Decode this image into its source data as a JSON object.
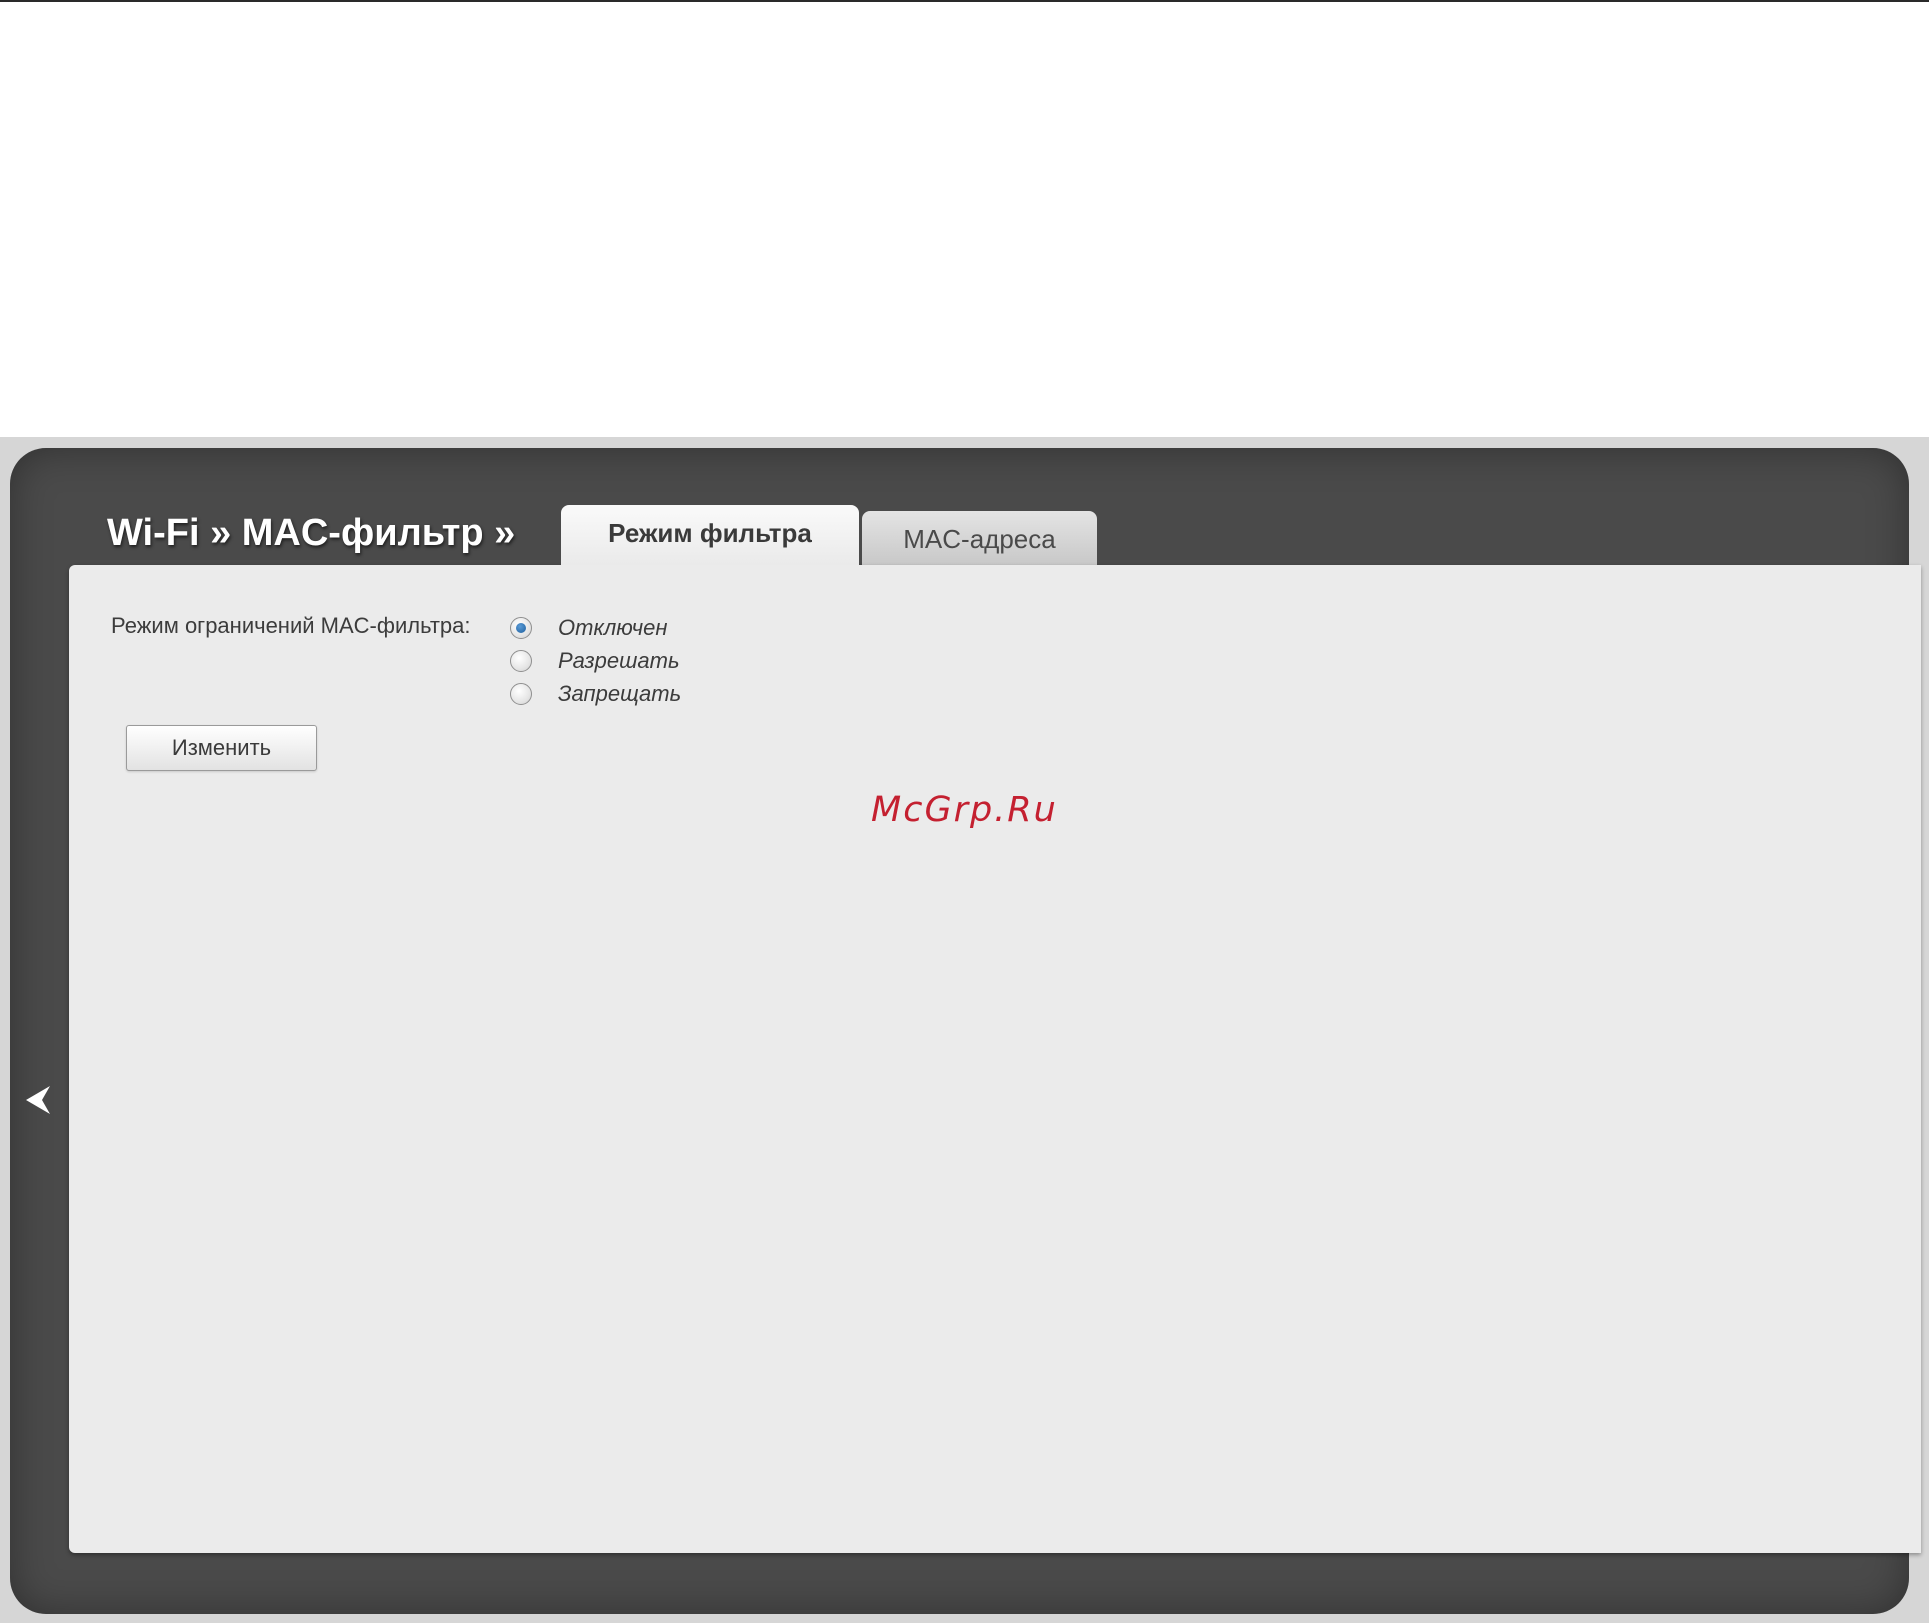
{
  "header": {
    "breadcrumb": "Wi-Fi » MAC-фильтр »"
  },
  "tabs": [
    {
      "label": "Режим фильтра",
      "active": true
    },
    {
      "label": "MAC-адреса",
      "active": false
    }
  ],
  "form": {
    "label": "Режим ограничений MAC-фильтра:",
    "options": [
      {
        "label": "Отключен",
        "checked": true
      },
      {
        "label": "Разрешать",
        "checked": false
      },
      {
        "label": "Запрещать",
        "checked": false
      }
    ],
    "submit_label": "Изменить"
  },
  "watermark": "McGrp.Ru",
  "icons": {
    "collapse": "chevron-left-icon",
    "radio_checked": "radio-checked-icon",
    "radio_unchecked": "radio-unchecked-icon"
  },
  "colors": {
    "panel_dark": "#4a4a4a",
    "content_bg": "#ebebeb",
    "watermark": "#c42030",
    "radio_selected": "#1d5f9e"
  }
}
